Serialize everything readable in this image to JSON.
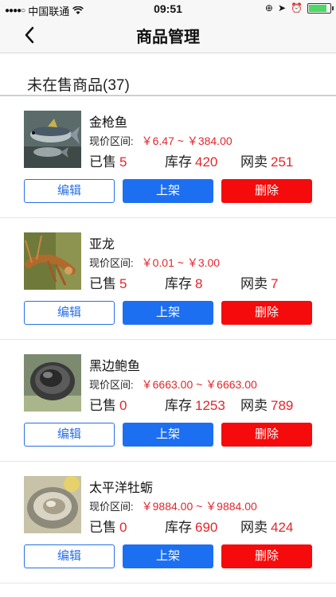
{
  "status_bar": {
    "carrier": "中国联通",
    "time": "09:51",
    "battery_color": "#4cd964",
    "battery_level": 0.85
  },
  "nav": {
    "title": "商品管理",
    "back_icon": "chevron-left-icon"
  },
  "section": {
    "title": "未在售商品(37)"
  },
  "labels": {
    "price_label": "现价区间:",
    "sold_label": "已售",
    "stock_label": "库存",
    "online_label": "网卖",
    "edit": "编辑",
    "list": "上架",
    "delete": "删除"
  },
  "items": [
    {
      "name": "金枪鱼",
      "price": "￥6.47 ~ ￥384.00",
      "sold": "5",
      "stock": "420",
      "online": "251"
    },
    {
      "name": "亚龙",
      "price": "￥0.01 ~ ￥3.00",
      "sold": "5",
      "stock": "8",
      "online": "7"
    },
    {
      "name": "黑边鲍鱼",
      "price": "￥6663.00 ~ ￥6663.00",
      "sold": "0",
      "stock": "1253",
      "online": "789"
    },
    {
      "name": "太平洋牡蛎",
      "price": "￥9884.00 ~ ￥9884.00",
      "sold": "0",
      "stock": "690",
      "online": "424"
    }
  ],
  "colors": {
    "accent_blue": "#1d6ff2",
    "delete_red": "#f50b0b",
    "value_red": "#e4262b"
  }
}
